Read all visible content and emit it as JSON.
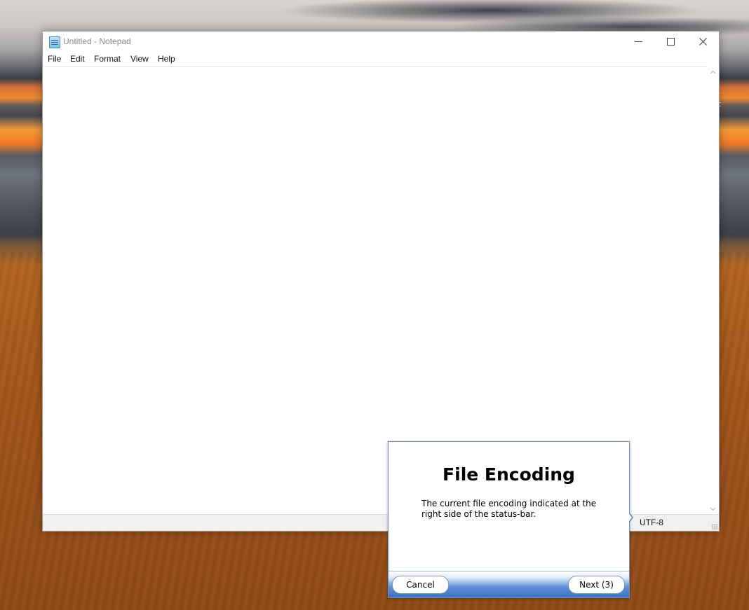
{
  "window": {
    "title": "Untitled - Notepad"
  },
  "menu": {
    "items": [
      "File",
      "Edit",
      "Format",
      "View",
      "Help"
    ]
  },
  "statusbar": {
    "encoding": "UTF-8"
  },
  "tour": {
    "title": "File Encoding",
    "body": "The current file encoding indicated at the right side of the status-bar.",
    "cancel_label": "Cancel",
    "next_label": "Next (3)"
  },
  "desktop": {
    "edge_text_1": "-",
    "edge_text_2": "t"
  },
  "icons": {
    "app": "notepad-icon",
    "minimize": "minimize-icon",
    "maximize": "maximize-icon",
    "close": "close-icon"
  }
}
